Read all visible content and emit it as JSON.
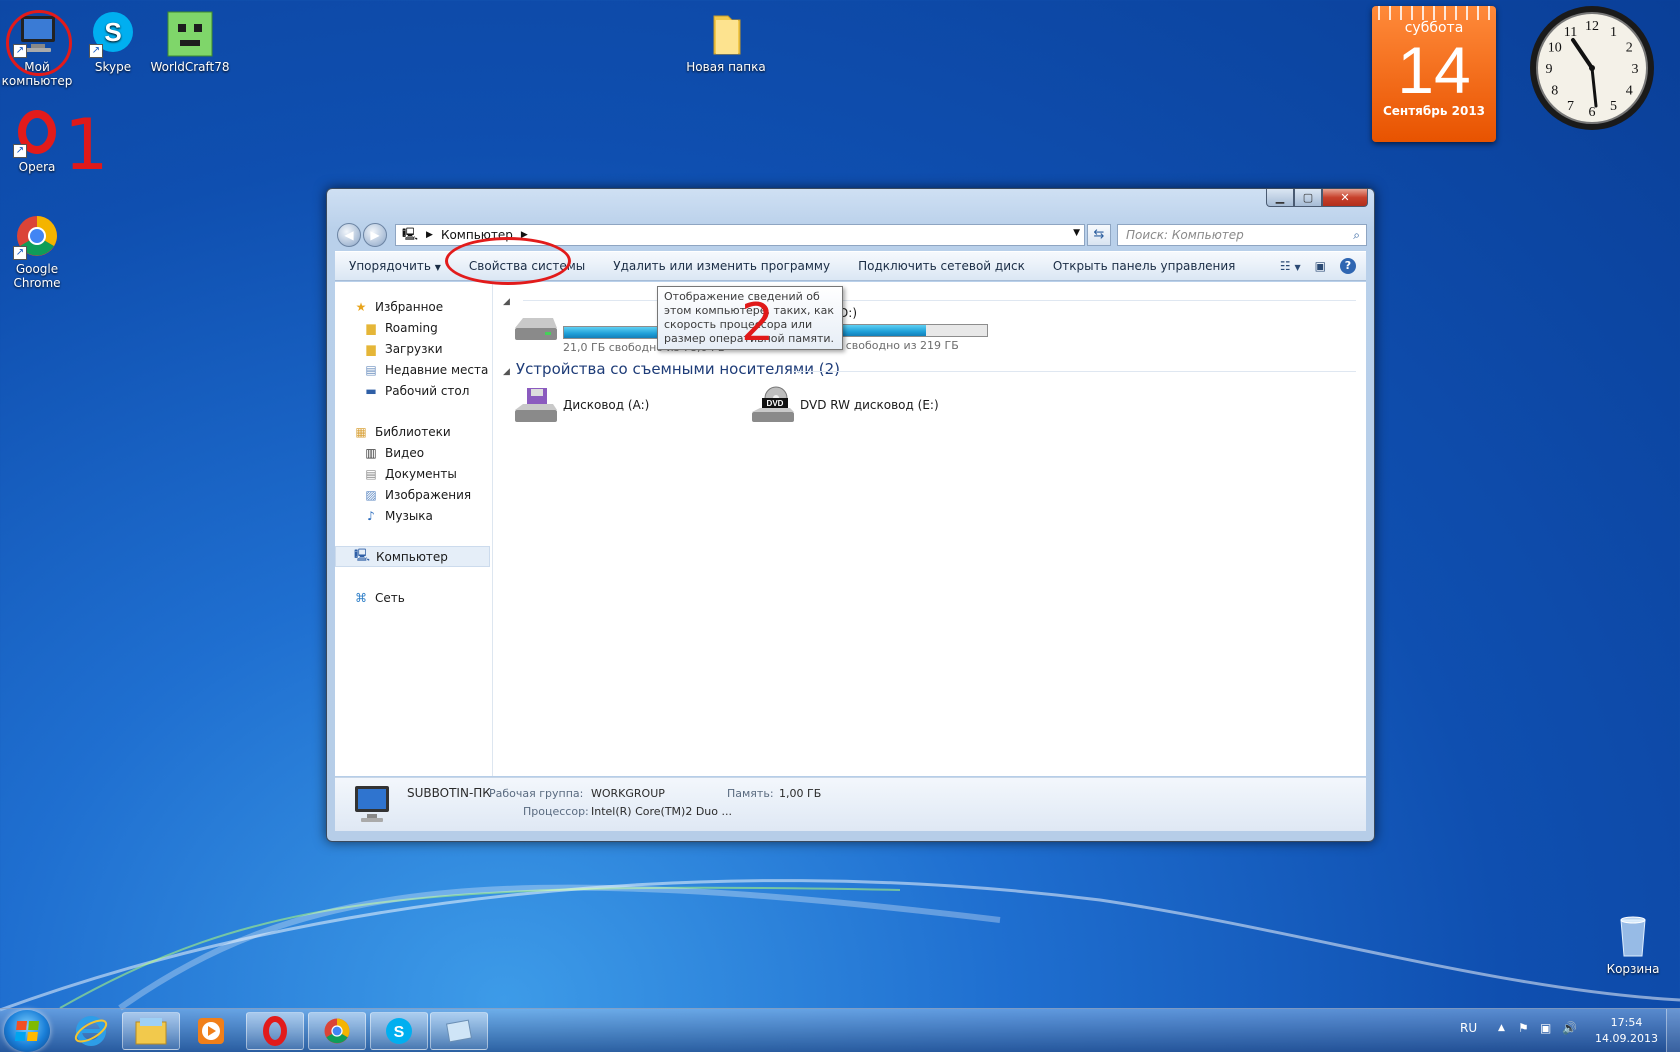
{
  "desktop": {
    "icons": {
      "my_computer": "Мой компьютер",
      "skype": "Skype",
      "worldcraft": "WorldCraft78",
      "new_folder": "Новая папка",
      "opera": "Opera",
      "chrome": "Google Chrome",
      "recycle_bin": "Корзина"
    },
    "annotations": {
      "one": "1",
      "two": "2"
    }
  },
  "calendar_gadget": {
    "weekday": "суббота",
    "day": "14",
    "month_year": "Сентябрь 2013"
  },
  "clock_gadget": {
    "numbers": [
      "12",
      "1",
      "2",
      "3",
      "4",
      "5",
      "6",
      "7",
      "8",
      "9",
      "10",
      "11"
    ]
  },
  "window": {
    "address": {
      "segment": "Компьютер"
    },
    "search": {
      "placeholder": "Поиск: Компьютер"
    },
    "toolbar": {
      "organize": "Упорядочить",
      "system_properties": "Свойства системы",
      "uninstall": "Удалить или изменить программу",
      "map_drive": "Подключить сетевой диск",
      "control_panel": "Открыть панель управления"
    },
    "tooltip": "Отображение сведений об этом компьютере, таких, как скорость процессора или размер оперативной памяти.",
    "sidebar": {
      "favorites": "Избранное",
      "fav_items": [
        "Roaming",
        "Загрузки",
        "Недавние места",
        "Рабочий стол"
      ],
      "libraries": "Библиотеки",
      "lib_items": [
        "Видео",
        "Документы",
        "Изображения",
        "Музыка"
      ],
      "computer": "Компьютер",
      "network": "Сеть"
    },
    "hdd_group": {
      "drive_c": {
        "free_text": "21,0 ГБ свободно из 78,0 ГБ",
        "used_fraction": 0.73
      },
      "drive_d": {
        "name": "5631 (D:)",
        "free_text": "71,2 ГБ свободно из 219 ГБ",
        "used_fraction": 0.67
      }
    },
    "removable_group": {
      "title": "Устройства со съемными носителями (2)",
      "floppy": "Дисковод (A:)",
      "dvd": "DVD RW дисковод (E:)",
      "dvd_badge": "DVD"
    },
    "details": {
      "pc_name": "SUBBOTIN-ПК",
      "workgroup_label": "Рабочая группа:",
      "workgroup": "WORKGROUP",
      "memory_label": "Память:",
      "memory": "1,00 ГБ",
      "cpu_label": "Процессор:",
      "cpu": "Intel(R) Core(TM)2 Duo ..."
    }
  },
  "taskbar": {
    "language": "RU",
    "time": "17:54",
    "date": "14.09.2013"
  },
  "colors": {
    "annotation_red": "#e21b1b",
    "calendar_orange": "#f26c1e",
    "desktop_blue": "#1f6fd0"
  }
}
